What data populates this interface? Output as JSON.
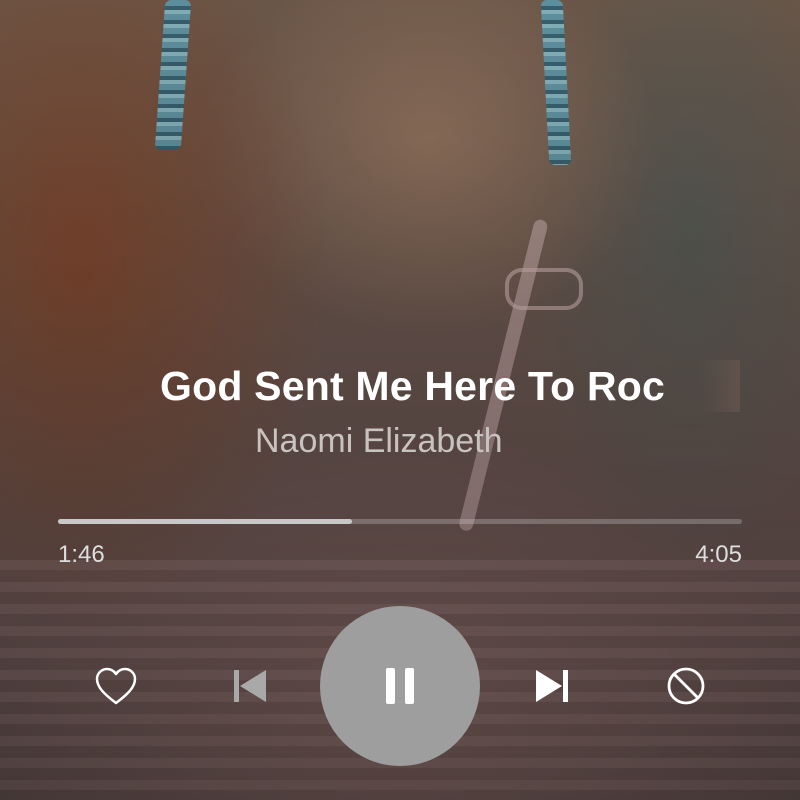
{
  "track": {
    "title": "God Sent Me Here To Roc",
    "artist": "Naomi Elizabeth"
  },
  "progress": {
    "current_time": "1:46",
    "total_time": "4:05",
    "fraction": 0.43
  },
  "controls": {
    "like_icon": "heart-outline-icon",
    "previous_icon": "skip-previous-icon",
    "play_pause_icon": "pause-icon",
    "next_icon": "skip-next-icon",
    "block_icon": "block-icon"
  },
  "colors": {
    "title": "#ffffff",
    "artist": "#c9c3c0",
    "play_button": "#9e9e9e",
    "progress_fill": "#c8c8c8"
  }
}
